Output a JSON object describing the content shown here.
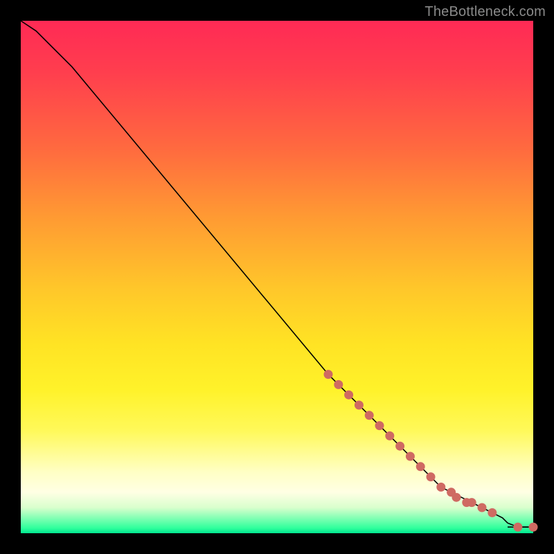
{
  "watermark": "TheBottleneck.com",
  "chart_data": {
    "type": "line",
    "title": "",
    "xlabel": "",
    "ylabel": "",
    "xlim": [
      0,
      100
    ],
    "ylim": [
      0,
      100
    ],
    "grid": false,
    "legend": false,
    "annotations": [],
    "series": [
      {
        "name": "curve",
        "color": "#000000",
        "x": [
          0,
          3,
          6,
          10,
          15,
          20,
          30,
          40,
          50,
          60,
          65,
          70,
          75,
          80,
          82,
          84,
          86,
          88,
          90,
          92,
          94,
          95,
          97,
          100
        ],
        "y": [
          100,
          98,
          95,
          91,
          85,
          79,
          67,
          55,
          43,
          31,
          26,
          21,
          16,
          11,
          9,
          8,
          7,
          6,
          5,
          4,
          3,
          2,
          1.2,
          1.2
        ]
      },
      {
        "name": "markers",
        "color": "#cf6a62",
        "x": [
          60,
          62,
          64,
          66,
          68,
          70,
          72,
          74,
          76,
          78,
          80,
          82,
          84,
          85,
          87,
          88,
          90,
          92,
          97,
          100
        ],
        "y": [
          31,
          29,
          27,
          25,
          23,
          21,
          19,
          17,
          15,
          13,
          11,
          9,
          8,
          7,
          6,
          6,
          5,
          4,
          1.2,
          1.2
        ]
      }
    ]
  }
}
